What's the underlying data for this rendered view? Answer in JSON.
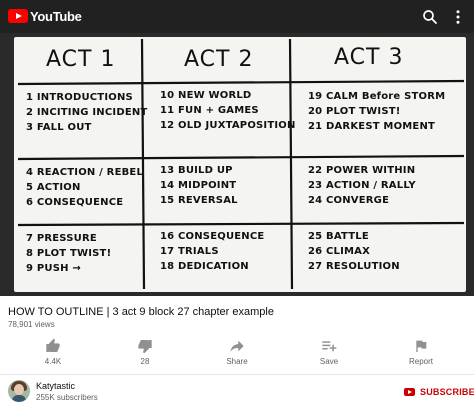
{
  "appbar": {
    "brand": "YouTube"
  },
  "board": {
    "headers": [
      "ACT 1",
      "ACT 2",
      "ACT 3"
    ],
    "rows": [
      [
        [
          "1 INTRODUCTIONS",
          "2 INCITING INCIDENT",
          "3 FALL OUT"
        ],
        [
          "10 NEW WORLD",
          "11 FUN + GAMES",
          "12 OLD JUXTAPOSITION"
        ],
        [
          "19 CALM Before STORM",
          "20 PLOT TWIST!",
          "21 DARKEST MOMENT"
        ]
      ],
      [
        [
          "4 REACTION / REBEL",
          "5 ACTION",
          "6 CONSEQUENCE"
        ],
        [
          "13 BUILD UP",
          "14 MIDPOINT",
          "15 REVERSAL"
        ],
        [
          "22 POWER WITHIN",
          "23 ACTION / RALLY",
          "24 CONVERGE"
        ]
      ],
      [
        [
          "7 PRESSURE",
          "8 PLOT TWIST!",
          "9 PUSH →"
        ],
        [
          "16 CONSEQUENCE",
          "17 TRIALS",
          "18 DEDICATION"
        ],
        [
          "25 BATTLE",
          "26 CLIMAX",
          "27 RESOLUTION"
        ]
      ]
    ]
  },
  "video": {
    "title": "HOW TO OUTLINE | 3 act 9 block 27 chapter example",
    "views": "78,901 views"
  },
  "actions": {
    "like": "4.4K",
    "dislike": "28",
    "share": "Share",
    "save": "Save",
    "report": "Report"
  },
  "channel": {
    "name": "Katytastic",
    "subscribers": "255K subscribers",
    "subscribe": "SUBSCRIBE"
  },
  "colors": {
    "appbar": "#212121",
    "brand_red": "#ff0000",
    "subscribe_red": "#cc0000",
    "secondary_text": "#606060"
  }
}
